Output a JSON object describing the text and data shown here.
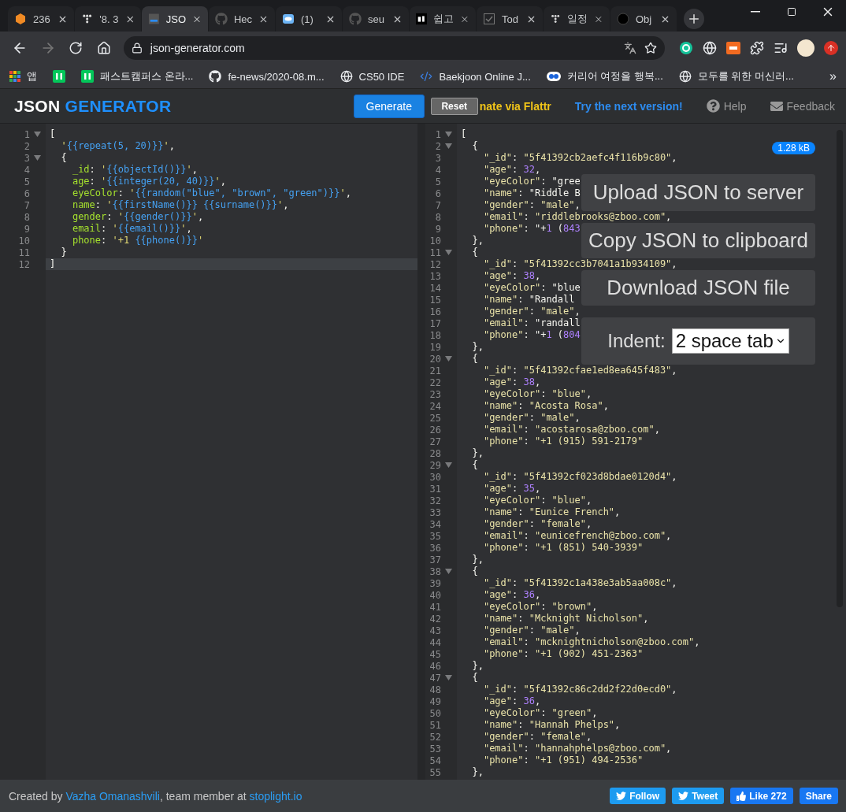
{
  "browser": {
    "tabs": [
      {
        "title": "236",
        "selected": false
      },
      {
        "title": "'8. 3",
        "selected": false
      },
      {
        "title": "JSO",
        "selected": true
      },
      {
        "title": "Hec",
        "selected": false
      },
      {
        "title": "(1)",
        "selected": false
      },
      {
        "title": "seu",
        "selected": false
      },
      {
        "title": "쉽고",
        "selected": false
      },
      {
        "title": "Tod",
        "selected": false
      },
      {
        "title": "일정",
        "selected": false
      },
      {
        "title": "Obj",
        "selected": false
      }
    ],
    "address": "json-generator.com",
    "forward_disabled": true,
    "bookmarks": [
      {
        "label": "앱"
      },
      {
        "label": "패스트캠퍼스 온라..."
      },
      {
        "label": "fe-news/2020-08.m..."
      },
      {
        "label": "CS50 IDE"
      },
      {
        "label": "Baekjoon Online J..."
      },
      {
        "label": "커리어 여정을 행복..."
      },
      {
        "label": "모두를 위한 머신러..."
      }
    ],
    "more": "»"
  },
  "header": {
    "logo": {
      "first": "JSON",
      "second": "GENERATOR"
    },
    "generate": "Generate",
    "reset": "Reset",
    "flattr": "nate via Flattr",
    "next_version": "Try the next version!",
    "help": "Help",
    "feedback": "Feedback"
  },
  "template_editor": {
    "lines": [
      {
        "number": "1",
        "code": "[",
        "fold": true,
        "active": false
      },
      {
        "number": "2",
        "code": "  '{{repeat(5, 20)}}',",
        "active": false
      },
      {
        "number": "3",
        "code": "  {",
        "fold": true,
        "active": false
      },
      {
        "number": "4",
        "code": "    _id: '{{objectId()}}',",
        "active": false
      },
      {
        "number": "5",
        "code": "    age: '{{integer(20, 40)}}',",
        "active": false
      },
      {
        "number": "6",
        "code": "    eyeColor: '{{random(\"blue\", \"brown\", \"green\")}}',",
        "active": false
      },
      {
        "number": "7",
        "code": "    name: '{{firstName()}} {{surname()}}',",
        "active": false
      },
      {
        "number": "8",
        "code": "    gender: '{{gender()}}',",
        "active": false
      },
      {
        "number": "9",
        "code": "    email: '{{email()}}',",
        "active": false
      },
      {
        "number": "10",
        "code": "    phone: '+1 {{phone()}}'",
        "active": false
      },
      {
        "number": "11",
        "code": "  }",
        "active": false
      },
      {
        "number": "12",
        "code": "]",
        "active": true
      }
    ]
  },
  "result_editor": {
    "size": "1.28 kB",
    "lines": [
      {
        "number": "1",
        "code": "[",
        "fold": true
      },
      {
        "number": "2",
        "code": "  {",
        "fold": true
      },
      {
        "number": "3",
        "code": "    \"_id\": \"5f41392cb2aefc4f116b9c80\","
      },
      {
        "number": "4",
        "code": "    \"age\": 32,"
      },
      {
        "number": "5",
        "code": "    \"eyeColor\": \"gree"
      },
      {
        "number": "6",
        "code": "    \"name\": \"Riddle B"
      },
      {
        "number": "7",
        "code": "    \"gender\": \"male\","
      },
      {
        "number": "8",
        "code": "    \"email\": \"riddlebrooks@zboo.com\","
      },
      {
        "number": "9",
        "code": "    \"phone\": \"+1 (843"
      },
      {
        "number": "10",
        "code": "  },"
      },
      {
        "number": "11",
        "code": "  {",
        "fold": true
      },
      {
        "number": "12",
        "code": "    \"_id\": \"5f41392cc3b7041a1b934109\","
      },
      {
        "number": "13",
        "code": "    \"age\": 38,"
      },
      {
        "number": "14",
        "code": "    \"eyeColor\": \"blue"
      },
      {
        "number": "15",
        "code": "    \"name\": \"Randall"
      },
      {
        "number": "16",
        "code": "    \"gender\": \"male\","
      },
      {
        "number": "17",
        "code": "    \"email\": \"randall"
      },
      {
        "number": "18",
        "code": "    \"phone\": \"+1 (804"
      },
      {
        "number": "19",
        "code": "  },"
      },
      {
        "number": "20",
        "code": "  {",
        "fold": true
      },
      {
        "number": "21",
        "code": "    \"_id\": \"5f41392cfae1ed8ea645f483\","
      },
      {
        "number": "22",
        "code": "    \"age\": 38,"
      },
      {
        "number": "23",
        "code": "    \"eyeColor\": \"blue\","
      },
      {
        "number": "24",
        "code": "    \"name\": \"Acosta Rosa\","
      },
      {
        "number": "25",
        "code": "    \"gender\": \"male\","
      },
      {
        "number": "26",
        "code": "    \"email\": \"acostarosa@zboo.com\","
      },
      {
        "number": "27",
        "code": "    \"phone\": \"+1 (915) 591-2179\""
      },
      {
        "number": "28",
        "code": "  },"
      },
      {
        "number": "29",
        "code": "  {",
        "fold": true
      },
      {
        "number": "30",
        "code": "    \"_id\": \"5f41392cf023d8bdae0120d4\","
      },
      {
        "number": "31",
        "code": "    \"age\": 35,"
      },
      {
        "number": "32",
        "code": "    \"eyeColor\": \"blue\","
      },
      {
        "number": "33",
        "code": "    \"name\": \"Eunice French\","
      },
      {
        "number": "34",
        "code": "    \"gender\": \"female\","
      },
      {
        "number": "35",
        "code": "    \"email\": \"eunicefrench@zboo.com\","
      },
      {
        "number": "36",
        "code": "    \"phone\": \"+1 (851) 540-3939\""
      },
      {
        "number": "37",
        "code": "  },"
      },
      {
        "number": "38",
        "code": "  {",
        "fold": true
      },
      {
        "number": "39",
        "code": "    \"_id\": \"5f41392c1a438e3ab5aa008c\","
      },
      {
        "number": "40",
        "code": "    \"age\": 36,"
      },
      {
        "number": "41",
        "code": "    \"eyeColor\": \"brown\","
      },
      {
        "number": "42",
        "code": "    \"name\": \"Mcknight Nicholson\","
      },
      {
        "number": "43",
        "code": "    \"gender\": \"male\","
      },
      {
        "number": "44",
        "code": "    \"email\": \"mcknightnicholson@zboo.com\","
      },
      {
        "number": "45",
        "code": "    \"phone\": \"+1 (902) 451-2363\""
      },
      {
        "number": "46",
        "code": "  },"
      },
      {
        "number": "47",
        "code": "  {",
        "fold": true
      },
      {
        "number": "48",
        "code": "    \"_id\": \"5f41392c86c2dd2f22d0ecd0\","
      },
      {
        "number": "49",
        "code": "    \"age\": 36,"
      },
      {
        "number": "50",
        "code": "    \"eyeColor\": \"green\","
      },
      {
        "number": "51",
        "code": "    \"name\": \"Hannah Phelps\","
      },
      {
        "number": "52",
        "code": "    \"gender\": \"female\","
      },
      {
        "number": "53",
        "code": "    \"email\": \"hannahphelps@zboo.com\","
      },
      {
        "number": "54",
        "code": "    \"phone\": \"+1 (951) 494-2536\""
      },
      {
        "number": "55",
        "code": "  },"
      }
    ],
    "actions": {
      "upload": "Upload JSON to server",
      "copy": "Copy JSON to clipboard",
      "download": "Download JSON file",
      "indent_label": "Indent:",
      "indent_value": "2 space tab"
    }
  },
  "footer": {
    "credit": {
      "before": "Created by",
      "author": "Vazha Omanashvili",
      "middle": ", team member at",
      "company": "stoplight.io"
    },
    "follow": "Follow",
    "tweet": "Tweet",
    "like": "Like",
    "like_count": "272",
    "share": "Share"
  }
}
